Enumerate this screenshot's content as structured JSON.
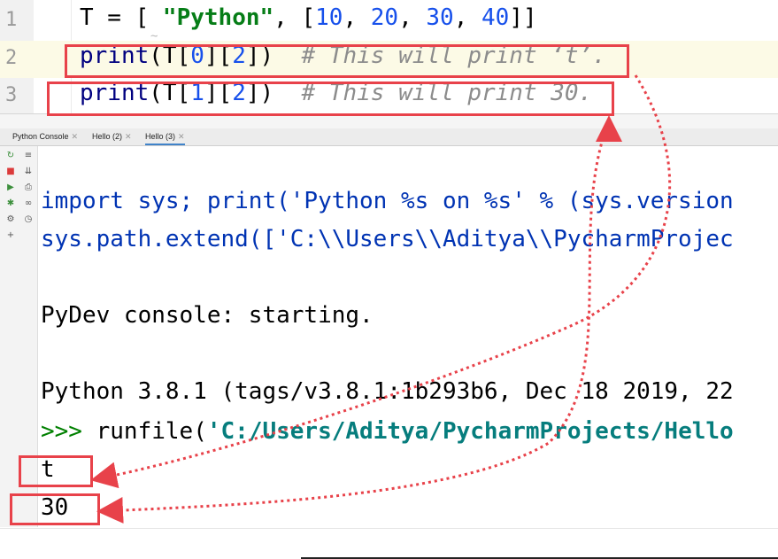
{
  "editor": {
    "lines": [
      {
        "number": "1",
        "parts": [
          "T = [ ",
          "\"Python\"",
          ", [",
          "10",
          ", ",
          "20",
          ", ",
          "30",
          ", ",
          "40",
          "]]"
        ]
      },
      {
        "number": "2",
        "parts": [
          "print",
          "(T[",
          "0",
          "][",
          "2",
          "])  ",
          "# This will print ‘t’."
        ]
      },
      {
        "number": "3",
        "parts": [
          "print",
          "(T[",
          "1",
          "][",
          "2",
          "])  ",
          "# This will print 30."
        ]
      }
    ]
  },
  "tabs": [
    {
      "label": "Python Console"
    },
    {
      "label": "Hello (2)"
    },
    {
      "label": "Hello (3)"
    }
  ],
  "console": {
    "line1": "import sys; print('Python %s on %s' % (sys.version",
    "line2": "sys.path.extend(['C:\\\\Users\\\\Aditya\\\\PycharmProjec",
    "line3": "PyDev console: starting.",
    "line4": "Python 3.8.1 (tags/v3.8.1:1b293b6, Dec 18 2019, 22",
    "prompt": ">>> ",
    "cmd_fn": "runfile(",
    "cmd_arg": "'C:/Users/Aditya/PycharmProjects/Hello",
    "out1": "t",
    "out2": "30"
  },
  "colors": {
    "annotation": "#e8424a",
    "string": "#067d17",
    "number": "#1750eb"
  }
}
